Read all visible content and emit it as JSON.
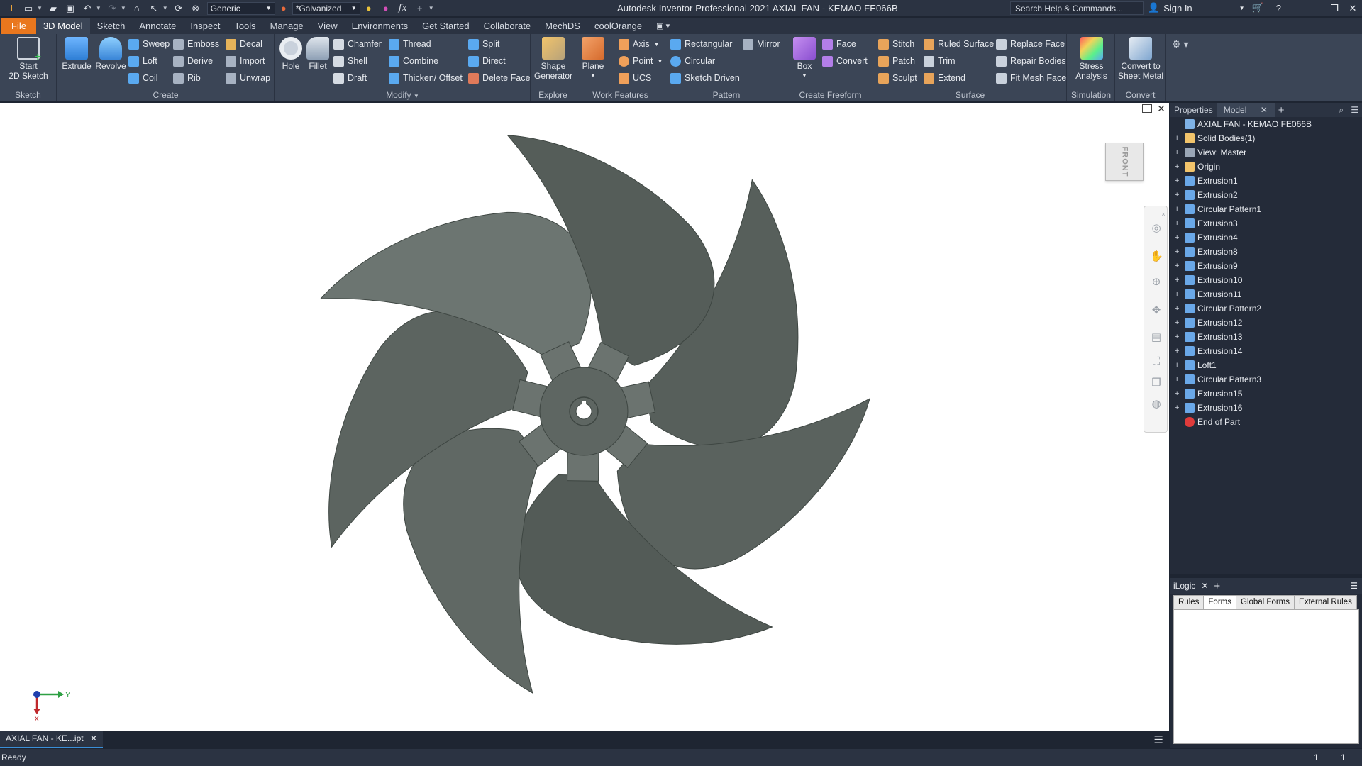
{
  "titlebar": {
    "style_combo": "Generic",
    "appearance_combo": "*Galvanized",
    "title": "Autodesk Inventor Professional 2021   AXIAL FAN - KEMAO FE066B",
    "search_placeholder": "Search Help & Commands...",
    "sign_in": "Sign In"
  },
  "tabs": [
    "File",
    "3D Model",
    "Sketch",
    "Annotate",
    "Inspect",
    "Tools",
    "Manage",
    "View",
    "Environments",
    "Get Started",
    "Collaborate",
    "MechDS",
    "coolOrange"
  ],
  "ribbon": {
    "sketch": {
      "label": "Sketch",
      "start_line1": "Start",
      "start_line2": "2D Sketch"
    },
    "create": {
      "label": "Create",
      "extrude": "Extrude",
      "revolve": "Revolve",
      "sweep": "Sweep",
      "loft": "Loft",
      "coil": "Coil",
      "emboss": "Emboss",
      "derive": "Derive",
      "rib": "Rib",
      "decal": "Decal",
      "import": "Import",
      "unwrap": "Unwrap"
    },
    "modify": {
      "label": "Modify",
      "hole": "Hole",
      "fillet": "Fillet",
      "chamfer": "Chamfer",
      "shell": "Shell",
      "draft": "Draft",
      "thread": "Thread",
      "combine": "Combine",
      "thicken": "Thicken/ Offset",
      "split": "Split",
      "direct": "Direct",
      "delete_face": "Delete Face"
    },
    "explore": {
      "label": "Explore",
      "shape_line1": "Shape",
      "shape_line2": "Generator"
    },
    "work": {
      "label": "Work Features",
      "plane": "Plane",
      "axis": "Axis",
      "point": "Point",
      "ucs": "UCS"
    },
    "pattern": {
      "label": "Pattern",
      "rectangular": "Rectangular",
      "circular": "Circular",
      "sketch_driven": "Sketch Driven",
      "mirror": "Mirror"
    },
    "freeform": {
      "label": "Create Freeform",
      "box": "Box",
      "face": "Face",
      "convert": "Convert"
    },
    "surface": {
      "label": "Surface",
      "stitch": "Stitch",
      "patch": "Patch",
      "sculpt": "Sculpt",
      "ruled": "Ruled Surface",
      "trim": "Trim",
      "extend": "Extend",
      "replace": "Replace Face",
      "repair": "Repair Bodies",
      "fitmesh": "Fit Mesh Face"
    },
    "simulation": {
      "label": "Simulation",
      "stress_line1": "Stress",
      "stress_line2": "Analysis"
    },
    "convert": {
      "label": "Convert",
      "sheet_line1": "Convert to",
      "sheet_line2": "Sheet Metal"
    }
  },
  "viewport": {
    "viewcube_label": "FRONT",
    "axis_y": "Y",
    "axis_x": "X"
  },
  "browser": {
    "tab_properties": "Properties",
    "tab_model": "Model",
    "items": [
      "AXIAL FAN - KEMAO FE066B",
      "Solid Bodies(1)",
      "View: Master",
      "Origin",
      "Extrusion1",
      "Extrusion2",
      "Circular Pattern1",
      "Extrusion3",
      "Extrusion4",
      "Extrusion8",
      "Extrusion9",
      "Extrusion10",
      "Extrusion11",
      "Circular Pattern2",
      "Extrusion12",
      "Extrusion13",
      "Extrusion14",
      "Loft1",
      "Circular Pattern3",
      "Extrusion15",
      "Extrusion16",
      "End of Part"
    ]
  },
  "ilogic": {
    "title": "iLogic",
    "tabs": [
      "Rules",
      "Forms",
      "Global Forms",
      "External Rules"
    ]
  },
  "document_tab": "AXIAL FAN - KE...ipt",
  "status": {
    "text": "Ready",
    "num1": "1",
    "num2": "1"
  }
}
